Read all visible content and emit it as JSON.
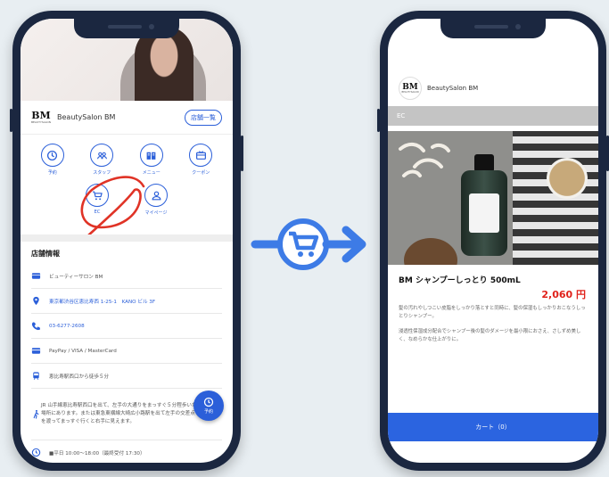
{
  "left_phone": {
    "brand": {
      "logo_letters": "BM",
      "logo_sub": "BEAUTYSALON",
      "name": "BeautySalon BM",
      "stores_button": "店舗一覧"
    },
    "menu": [
      {
        "label": "予約",
        "icon": "clock-icon"
      },
      {
        "label": "スタッフ",
        "icon": "staff-icon"
      },
      {
        "label": "メニュー",
        "icon": "book-icon"
      },
      {
        "label": "クーポン",
        "icon": "coupon-icon"
      },
      {
        "label": "EC",
        "icon": "cart-icon"
      },
      {
        "label": "マイページ",
        "icon": "user-icon"
      }
    ],
    "info": {
      "title": "店舗情報",
      "name": "ビューティーサロン BM",
      "address": "東京都渋谷区恵比寿西 1-25-1　KANO ビル 3F",
      "phone": "03-6277-2608",
      "payment": "PayPay / VISA / MasterCard",
      "station": "恵比寿駅西口から徒歩５分",
      "directions": "JR 山手線恵比寿駅西口を出て、左手の大通りをまっすぐ５分程歩いた場所にあります。または東急東横線大崎広小路駅を出て左手の交差点を渡ってまっすぐ行くと右手に見えます。",
      "hours": "■平日 10:00〜18:00（最終受付 17:30）"
    },
    "fab_label": "予約"
  },
  "right_phone": {
    "brand": {
      "logo_letters": "BM",
      "logo_sub": "BEAUTYSALON",
      "name": "BeautySalon BM"
    },
    "section": "EC",
    "product": {
      "name": "BM シャンプーしっとり 500mL",
      "price": "2,060 円",
      "desc1": "髪の汚れやしつこい皮脂をしっかり落とすと同時に、髪の保湿もしっかりおこなうしっとりシャンプー。",
      "desc2": "浸透性保湿成分配合でシャンプー後の髪のダメージを最小限におさえ、さしずめ美しく、なめらかな仕上がりに。"
    },
    "cart_button": "カート（0）"
  },
  "colors": {
    "accent": "#2b5fd9",
    "price": "#e0211a",
    "frame": "#1b2740",
    "scribble": "#e03326"
  }
}
